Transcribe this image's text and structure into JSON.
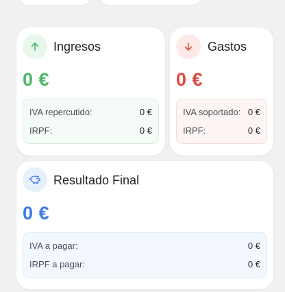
{
  "colors": {
    "income": "#4cb866",
    "income_bg": "#e8f6ec",
    "income_box_bg": "#f5fbf7",
    "income_box_border": "#d9eedf",
    "expense": "#e0483d",
    "expense_bg": "#fce9e8",
    "expense_box_bg": "#fdf5f4",
    "expense_box_border": "#f6dcd9",
    "result": "#3a7be8",
    "result_bg": "#e6f0fc",
    "result_box_bg": "#f3f8fe",
    "result_box_border": "#dde9f8"
  },
  "income": {
    "icon": "arrow-up-icon",
    "title": "Ingresos",
    "amount": "0 €",
    "rows": [
      {
        "label": "IVA repercutido:",
        "value": "0 €"
      },
      {
        "label": "IRPF:",
        "value": "0 €"
      }
    ]
  },
  "expenses": {
    "icon": "arrow-down-icon",
    "title": "Gastos",
    "amount": "0 €",
    "rows": [
      {
        "label": "IVA soportado:",
        "value": "0 €"
      },
      {
        "label": "IRPF:",
        "value": "0 €"
      }
    ]
  },
  "result": {
    "icon": "piggy-bank-icon",
    "title": "Resultado Final",
    "amount": "0 €",
    "rows": [
      {
        "label": "IVA a pagar:",
        "value": "0 €"
      },
      {
        "label": "IRPF a pagar:",
        "value": "0 €"
      }
    ]
  }
}
